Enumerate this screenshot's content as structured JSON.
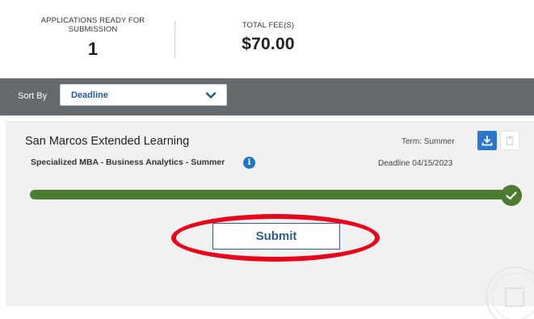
{
  "summary": {
    "ready_label": "APPLICATIONS READY FOR SUBMISSION",
    "ready_count": "1",
    "fee_label": "TOTAL FEE(S)",
    "fee_value": "$70.00"
  },
  "sort": {
    "label": "Sort By",
    "selected": "Deadline"
  },
  "application": {
    "school": "San Marcos Extended Learning",
    "program": "Specialized MBA - Business Analytics - Summer",
    "term": "Term: Summer",
    "deadline": "Deadline 04/15/2023",
    "progress_percent": 100
  },
  "actions": {
    "submit_label": "Submit"
  },
  "icons": {
    "info": "info-icon",
    "download": "download-icon",
    "delete": "trash-icon",
    "complete": "check-icon",
    "dropdown": "chevron-down-icon"
  },
  "colors": {
    "accent": "#2c76cc",
    "progress": "#4b7c30",
    "sortbar": "#646a6e",
    "highlight": "#e8071a"
  }
}
